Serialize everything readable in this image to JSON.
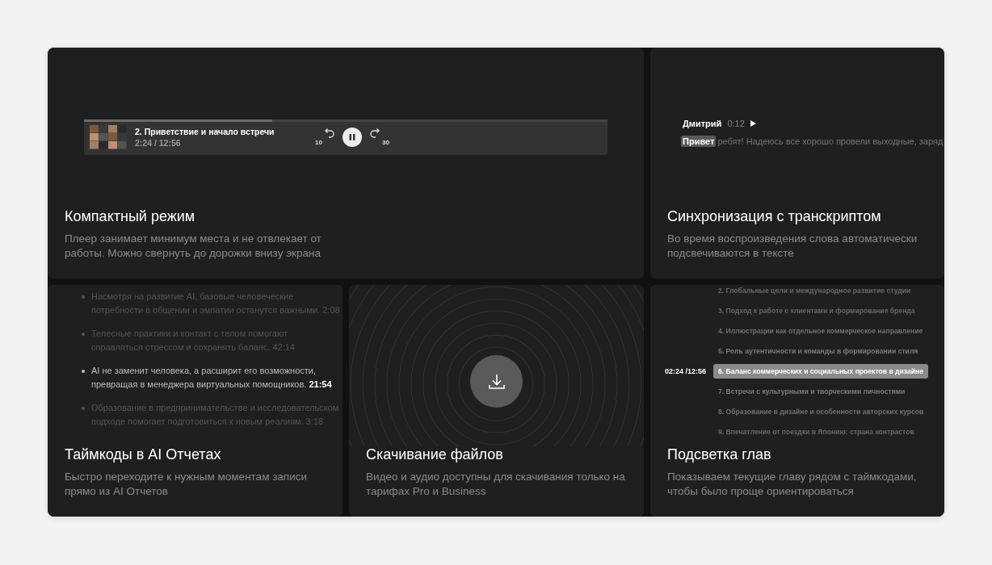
{
  "cards": [
    {
      "kind": "player",
      "title": "Компактный режим",
      "description": "Плеер занимает минимум места и не отвлекает от работы. Можно свернуть до дорожки внизу экрана",
      "player": {
        "track": "2. Приветствие и начало встречи",
        "time": "2:24 / 12:56",
        "level": 0.36,
        "back_label": "10",
        "forward_label": "30",
        "playing": true
      }
    },
    {
      "kind": "transcript",
      "title": "Синхронизация с транскриптом",
      "description": "Во время воспроизведения слова автоматически подсвечиваются в тексте",
      "transcript": {
        "speaker": "Дмитрий",
        "time": "0:12",
        "highlight": "Привет",
        "rest": "ребят! Надеюсь все хорошо провели выходные, заряд"
      }
    },
    {
      "kind": "timecodes",
      "title": "Таймкоды в AI Отчетах",
      "description": "Быстро переходите к нужным моментам записи прямо из AI Отчетов",
      "items": [
        {
          "text": "Насмотря на развитие AI, базовые человеческие потребности в общении и эмпатии останутся важными.",
          "time": "2:08",
          "active": false
        },
        {
          "text": "Телесные практики и контакт с телом помогают справляться стрессом и сохранять баланс.",
          "time": "42:14",
          "active": false
        },
        {
          "text": "AI не заменит человека, а расширит его возможности, превращая в менеджера виртуальных помощников.",
          "time": "21:54",
          "active": true
        },
        {
          "text": "Образование в предпринимательстве и исследовательском подходе помогает подготовиться к новым реалиям.",
          "time": "3:18",
          "active": false
        }
      ]
    },
    {
      "kind": "download",
      "title": "Скачивание файлов",
      "description": "Видео и аудио доступны для скачивания только на тарифах Pro и Business"
    },
    {
      "kind": "chapters",
      "title": "Подсветка глав",
      "description": "Показываем текущие главу рядом с таймкодами, чтобы было проще ориентироваться",
      "current_time": "02:24 /12:56",
      "chapters": [
        {
          "label": "2. Глобальные цели и международное развитие студии",
          "selected": false
        },
        {
          "label": "3. Подход к работе с клиентами и формирование бренда",
          "selected": false
        },
        {
          "label": "4. Иллюстрации как отдельное коммерческое направление",
          "selected": false
        },
        {
          "label": "5. Роль аутентичности и команды в формировании стиля",
          "selected": false
        },
        {
          "label": "6. Баланс коммерческих и социальных проектов в дизайне",
          "selected": true
        },
        {
          "label": "7. Встречи с культурными и творческими личностями",
          "selected": false
        },
        {
          "label": "8. Образование в дизайне и особенности авторских курсов",
          "selected": false
        },
        {
          "label": "9. Впечатление от поездки в Японию: страна контрастов",
          "selected": false
        }
      ]
    }
  ]
}
